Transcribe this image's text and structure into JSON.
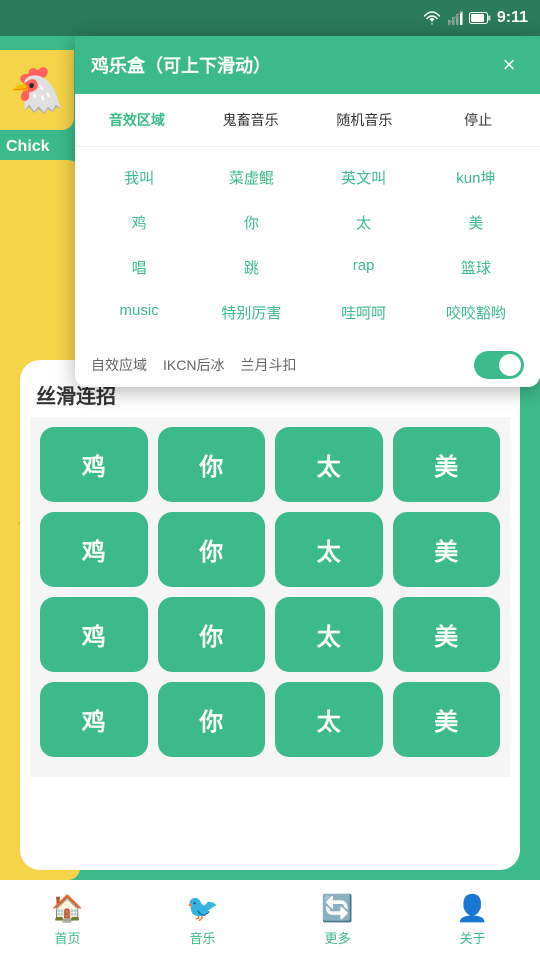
{
  "statusBar": {
    "time": "9:11",
    "icons": [
      "wifi",
      "signal",
      "battery"
    ]
  },
  "modal": {
    "title": "鸡乐盒（可上下滑动）",
    "closeLabel": "×",
    "tabs": [
      {
        "label": "音效区域",
        "active": true
      },
      {
        "label": "鬼畜音乐",
        "active": false
      },
      {
        "label": "随机音乐",
        "active": false
      },
      {
        "label": "停止",
        "active": false
      }
    ],
    "soundGrid": [
      "我叫",
      "菜虚鲲",
      "英文叫",
      "kun坤",
      "鸡",
      "你",
      "太",
      "美",
      "唱",
      "跳",
      "rap",
      "篮球",
      "music",
      "特别厉害",
      "哇呵呵",
      "咬咬豁哟"
    ],
    "toggleLabels": [
      "自效应域",
      "IKCN后冰",
      "兰月斗扣"
    ],
    "comboTitle": "丝滑连招",
    "comboRows": [
      [
        "鸡",
        "你",
        "太",
        "美"
      ],
      [
        "鸡",
        "你",
        "太",
        "美"
      ],
      [
        "鸡",
        "你",
        "太",
        "美"
      ],
      [
        "鸡",
        "你",
        "太",
        "美"
      ]
    ]
  },
  "bottomNav": {
    "items": [
      {
        "label": "首页",
        "icon": "🏠"
      },
      {
        "label": "音乐",
        "icon": "🐦"
      },
      {
        "label": "更多",
        "icon": "🔄"
      },
      {
        "label": "关于",
        "icon": "👤"
      }
    ]
  },
  "background": {
    "chickLabel": "Chick"
  }
}
